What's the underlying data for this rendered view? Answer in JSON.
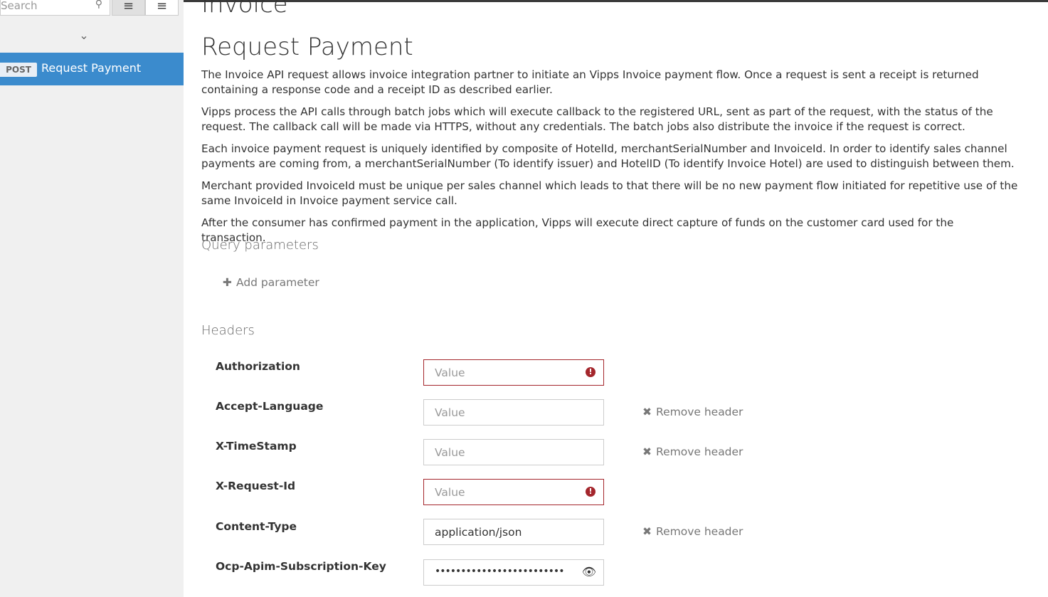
{
  "sidebar": {
    "search_placeholder": "Search",
    "search_icon": "search-icon",
    "view_list_icon": "list-icon",
    "view_tag_icon": "tag-group-icon",
    "collapse_icon": "chevron-down-icon",
    "operation": {
      "method": "POST",
      "label": "Request Payment"
    }
  },
  "main": {
    "api_title": "Invoice",
    "operation_title": "Request Payment",
    "description": [
      "The Invoice API request allows invoice integration partner to initiate an Vipps Invoice payment flow. Once a request is sent a receipt is returned containing a response code and a receipt ID as described earlier.",
      "Vipps process the API calls through batch jobs which will execute callback to the registered URL, sent as part of the request, with the status of the request. The callback call will be made via HTTPS, without any credentials. The batch jobs also distribute the invoice if the request is correct.",
      "Each invoice payment request is uniquely identified by composite of HotelId, merchantSerialNumber and InvoiceId. In order to identify sales channel payments are coming from, a merchantSerialNumber (To identify issuer) and HotelID (To identify Invoice Hotel) are used to distinguish between them.",
      "Merchant provided InvoiceId must be unique per sales channel which leads to that there will be no new payment flow initiated for repetitive use of the same InvoiceId in Invoice payment service call.",
      "After the consumer has confirmed payment in the application, Vipps will execute direct capture of funds on the customer card used for the transaction."
    ],
    "query_params_title": "Query parameters",
    "add_parameter_label": "Add parameter",
    "headers_title": "Headers",
    "remove_header_label": "Remove header",
    "headers": [
      {
        "name": "Authorization",
        "placeholder": "Value",
        "value": "",
        "error": true,
        "removable": false
      },
      {
        "name": "Accept-Language",
        "placeholder": "Value",
        "value": "",
        "error": false,
        "removable": true
      },
      {
        "name": "X-TimeStamp",
        "placeholder": "Value",
        "value": "",
        "error": false,
        "removable": true
      },
      {
        "name": "X-Request-Id",
        "placeholder": "Value",
        "value": "",
        "error": true,
        "removable": false
      },
      {
        "name": "Content-Type",
        "placeholder": "Value",
        "value": "application/json",
        "error": false,
        "removable": true
      },
      {
        "name": "Ocp-Apim-Subscription-Key",
        "placeholder": "Value",
        "value": "•••••••••••••••••••••••••",
        "error": false,
        "removable": false,
        "secret": true
      }
    ]
  },
  "colors": {
    "accent": "#3b8bcd",
    "error": "#a4262c",
    "sidebar_bg": "#f0f0f0"
  }
}
